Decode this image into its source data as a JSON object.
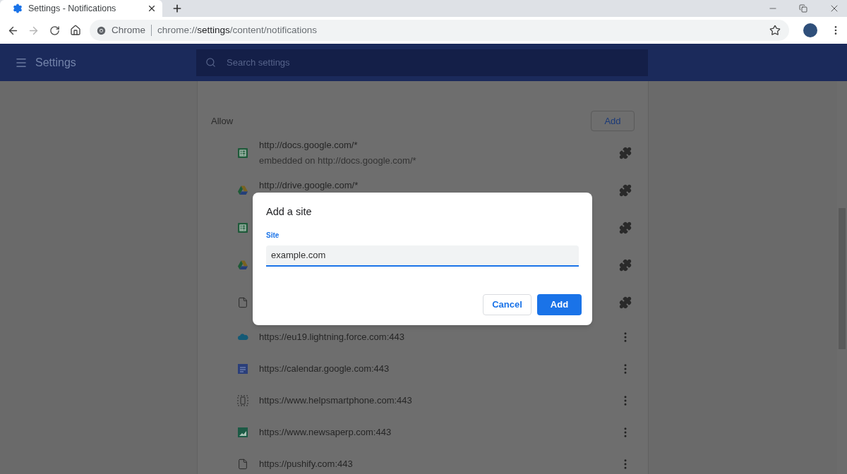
{
  "tab": {
    "title": "Settings - Notifications",
    "selected": true
  },
  "toolbar": {
    "forward_disabled": true,
    "chip": "Chrome",
    "url": {
      "scheme": "chrome://",
      "host": "settings",
      "path": "/content/notifications"
    }
  },
  "header": {
    "title": "Settings",
    "search_placeholder": "Search settings"
  },
  "allow": {
    "title": "Allow",
    "add_button": "Add"
  },
  "sites": [
    {
      "kind": "sheets",
      "url": "http://docs.google.com/*",
      "subtitle": "embedded on http://docs.google.com/*",
      "by_extension": true
    },
    {
      "kind": "drive",
      "url": "http://drive.google.com/*",
      "by_extension": true
    },
    {
      "kind": "sheets",
      "by_extension": true
    },
    {
      "kind": "drive",
      "by_extension": true
    },
    {
      "kind": "file",
      "by_extension": true
    },
    {
      "kind": "cloud",
      "url": "https://eu19.lightning.force.com:443",
      "by_extension": false
    },
    {
      "kind": "calendar",
      "url": "https://calendar.google.com:443",
      "by_extension": false
    },
    {
      "kind": "phone",
      "url": "https://www.helpsmartphone.com:443",
      "by_extension": false
    },
    {
      "kind": "chart",
      "url": "https://www.newsaperp.com:443",
      "by_extension": false
    },
    {
      "kind": "file",
      "url": "https://pushify.com:443",
      "by_extension": false
    }
  ],
  "dialog": {
    "title": "Add a site",
    "field_label": "Site",
    "field_value": "example.com",
    "focused": true,
    "buttons": [
      {
        "label": "Cancel",
        "kind": "secondary"
      },
      {
        "label": "Add",
        "kind": "primary"
      }
    ]
  }
}
